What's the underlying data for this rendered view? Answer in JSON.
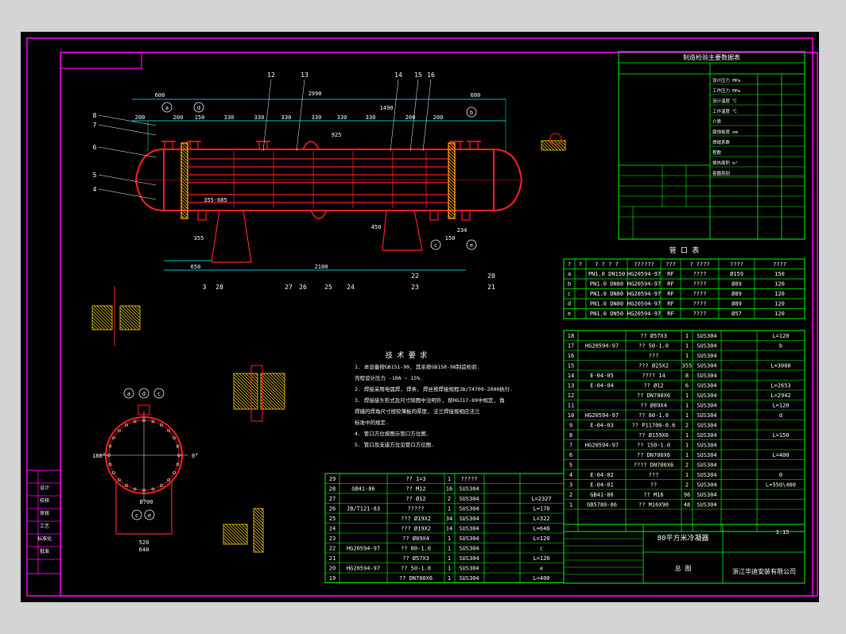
{
  "drawing": {
    "title": "80平方米冷凝器",
    "company": "浙江华迪安装有限公司",
    "drawing_type": "总 图",
    "tech_req_title": "技 术 要 求",
    "tech_req_items": [
      "1. 本设备按GB151-99, 其余按GB150-98制造检验.",
      "   壳程设计压力 -10A ~ 15%.",
      "2. 焊接采用电弧焊, 焊条, 焊丝按焊接规程JB/T4709-2000执行.",
      "3. 焊接接头形式及尺寸除图中注明外, 按HGJ17-89中规定, 角",
      "   焊缝的焊角尺寸按较薄板的厚度, 法兰焊接按相应法兰",
      "   标准中的规定.",
      "4. 管口方位按图示管口方位图.",
      "5. 管口及支座方位见管口方位图."
    ],
    "scale": "1:15",
    "label_80": "80平方米冷凝器"
  },
  "colors": {
    "sheet": "#000000",
    "border": "#ff00ff",
    "table": "#00ff00",
    "vessel": "#ff2020",
    "dim": "#00ffff",
    "text": "#ffffff",
    "hatch": "#ffd700",
    "leader": "#ffffff"
  },
  "design_table": {
    "title": "制造检验主要数据表",
    "rows": [
      "设计压力 MPa",
      "工作压力 MPa",
      "设计温度 ℃",
      "工作温度 ℃",
      "介质",
      "腐蚀裕度 mm",
      "焊缝系数",
      "程数",
      "换热面积 m²",
      "容器类别"
    ]
  },
  "nozzle_table": {
    "title": "管 口 表",
    "headers": [
      "?",
      "?",
      "? ? ? ?",
      "??????",
      "???",
      "? ????",
      "????",
      "????"
    ],
    "rows": [
      [
        "a",
        "PN1.0 DN150",
        "HG20594-97",
        "RF",
        "????",
        "Ø159",
        "150"
      ],
      [
        "b",
        "PN1.0 DN80",
        "HG20594-97",
        "RF",
        "????",
        "Ø89",
        "120"
      ],
      [
        "c",
        "PN1.0 DN80",
        "HG20594-97",
        "RF",
        "????",
        "Ø89",
        "120"
      ],
      [
        "d",
        "PN1.0 DN80",
        "HG20594-97",
        "RF",
        "????",
        "Ø89",
        "120"
      ],
      [
        "e",
        "PN1.0 DN50",
        "HG20594-97",
        "RF",
        "????",
        "Ø57",
        "120"
      ]
    ]
  },
  "parts_right": [
    [
      "18",
      "",
      "?? Ø57X3",
      "1",
      "SUS304",
      "L=120"
    ],
    [
      "17",
      "HG20594-97",
      "?? 50-1.0",
      "1",
      "SUS304",
      "b"
    ],
    [
      "16",
      "",
      "???",
      "1",
      "SUS304",
      ""
    ],
    [
      "15",
      "",
      "??? Ø25X2",
      "355",
      "SUS304",
      "L=3000"
    ],
    [
      "14",
      "E-04-05",
      "???? 14",
      "8",
      "SUS304",
      ""
    ],
    [
      "13",
      "E-04-04",
      "?? Ø12",
      "6",
      "SUS304",
      "L=2653"
    ],
    [
      "12",
      "",
      "?? DN700X6",
      "1",
      "SUS304",
      "L=2942"
    ],
    [
      "11",
      "",
      "?? Ø89X4",
      "1",
      "SUS304",
      "L=120"
    ],
    [
      "10",
      "HG20594-97",
      "?? 80-1.0",
      "1",
      "SUS304",
      "d"
    ],
    [
      "9",
      "E-04-03",
      "?? P11700-0.6",
      "2",
      "SUS304",
      ""
    ],
    [
      "8",
      "",
      "?? Ø159X6",
      "1",
      "SUS304",
      "L=150"
    ],
    [
      "7",
      "HG20594-97",
      "?? 150-1.0",
      "1",
      "SUS304",
      ""
    ],
    [
      "6",
      "",
      "?? DN700X6",
      "1",
      "SUS304",
      "L=400"
    ],
    [
      "5",
      "",
      "???? DN700X6",
      "2",
      "SUS304",
      ""
    ],
    [
      "4",
      "E-04-02",
      "???",
      "1",
      "SUS304",
      "0"
    ],
    [
      "3",
      "E-04-01",
      "??",
      "2",
      "SUS304",
      "L=550\\400"
    ],
    [
      "2",
      "GB41-86",
      "?? M16",
      "96",
      "SUS304",
      ""
    ],
    [
      "1",
      "GB5780-86",
      "?? M16X90",
      "48",
      "SUS304",
      ""
    ]
  ],
  "parts_left": [
    [
      "29",
      "",
      "?? 1=3",
      "1",
      "?????",
      ""
    ],
    [
      "28",
      "GB41-86",
      "?? M12",
      "16",
      "SUS304",
      ""
    ],
    [
      "27",
      "",
      "?? Ø12",
      "2",
      "SUS304",
      "L=2327"
    ],
    [
      "26",
      "JB/T121-83",
      "????? ",
      "1",
      "SUS304",
      "L=170"
    ],
    [
      "25",
      "",
      "??? Ø19X2",
      "34",
      "SUS304",
      "L=322"
    ],
    [
      "24",
      "",
      "??? Ø19X2",
      "14",
      "SUS304",
      "L=648"
    ],
    [
      "23",
      "",
      "?? Ø89X4",
      "1",
      "SUS304",
      "L=120"
    ],
    [
      "22",
      "HG20594-97",
      "?? 80-1.0",
      "1",
      "SUS304",
      "c"
    ],
    [
      "21",
      "",
      "?? Ø57X3",
      "1",
      "SUS304",
      "L=120"
    ],
    [
      "20",
      "HG20594-97",
      "?? 50-1.0",
      "1",
      "SUS304",
      "e"
    ],
    [
      "19",
      "",
      "?? DN700X6",
      "1",
      "SUS304",
      "L=400"
    ]
  ],
  "dimensions": {
    "top": [
      "600",
      "2990",
      "600",
      "1490",
      "200",
      "200",
      "150",
      "330",
      "330",
      "330",
      "330",
      "330",
      "330",
      "200",
      "200"
    ],
    "bottom": [
      "650",
      "2100",
      "234",
      "150"
    ],
    "side": [
      "355",
      "450",
      "925",
      "355-685"
    ]
  },
  "balloons_top": [
    "12",
    "13",
    "14",
    "15",
    "16"
  ],
  "balloons_left": [
    "8",
    "7",
    "6",
    "5",
    "4"
  ],
  "balloons_bottom": [
    "3",
    "28",
    "27",
    "26",
    "25",
    "24",
    "23",
    "22",
    "21",
    "20"
  ],
  "nozzle_marks": [
    "a",
    "d",
    "c",
    "b",
    "e"
  ],
  "section_labels": [
    "0°",
    "180°",
    "Ø700",
    "520",
    "640"
  ],
  "title_small": [
    "设计",
    "校核",
    "审核",
    "工艺",
    "标准化",
    "批准"
  ]
}
